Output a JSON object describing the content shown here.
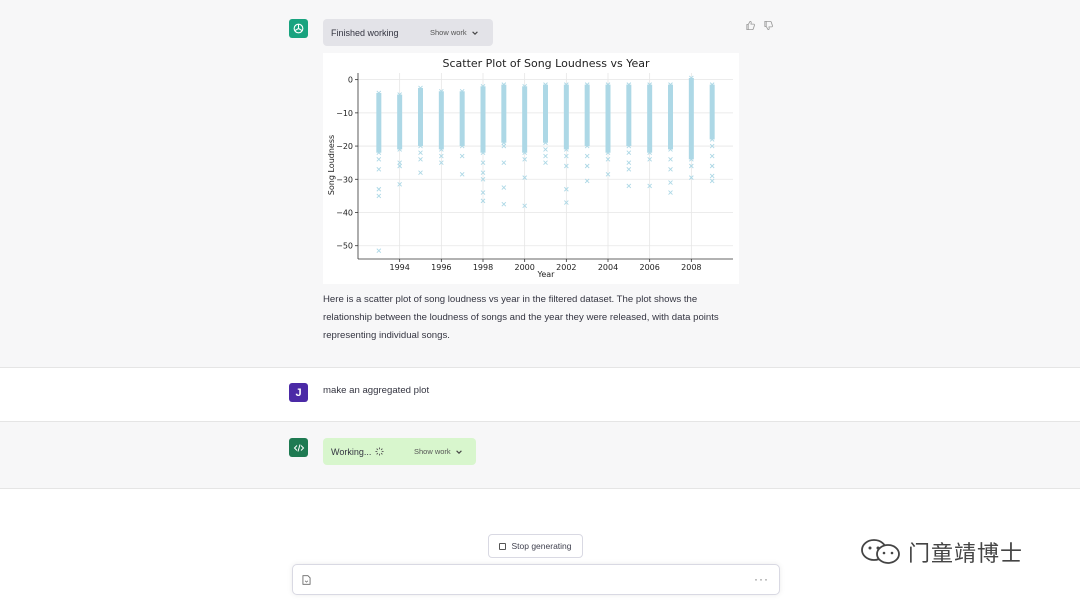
{
  "messages": {
    "assistant1": {
      "work_status": "Finished working",
      "show_work": "Show work",
      "paragraph": "Here is a scatter plot of song loudness vs year in the filtered dataset. The plot shows the relationship between the loudness of songs and the year they were released, with data points representing individual songs."
    },
    "user": {
      "avatar_letter": "J",
      "text": "make an aggregated plot"
    },
    "assistant2": {
      "work_status": "Working...",
      "show_work": "Show work"
    }
  },
  "controls": {
    "stop_label": "Stop generating",
    "more_label": "···"
  },
  "watermark": {
    "text": "门童靖博士"
  },
  "icons": {
    "gpt_avatar": "openai-logo-icon",
    "code_avatar": "code-icon",
    "thumbs_up": "thumbs-up-icon",
    "thumbs_down": "thumbs-down-icon",
    "spinner": "spinner-icon",
    "chevron": "chevron-down-icon",
    "stop": "stop-square-icon",
    "file": "file-icon"
  },
  "colors": {
    "gpt_green": "#19a37f",
    "user_purple": "#4b2aa6",
    "code_green": "#1e7a52",
    "working_bg": "#d8f6cd",
    "points": "#add8e6"
  },
  "chart_data": {
    "type": "scatter",
    "title": "Scatter Plot of Song Loudness vs Year",
    "xlabel": "Year",
    "ylabel": "Song Loudness",
    "xlim": [
      1992,
      2010
    ],
    "ylim": [
      -54,
      2
    ],
    "xticks": [
      1994,
      1996,
      1998,
      2000,
      2002,
      2004,
      2006,
      2008
    ],
    "yticks": [
      0,
      -10,
      -20,
      -30,
      -40,
      -50
    ],
    "grid": true,
    "marker": "x",
    "series": [
      {
        "points": [
          {
            "year": 1993,
            "band": [
              -4,
              -22
            ],
            "outliers": [
              -24,
              -27,
              -33,
              -35,
              -51.5
            ]
          },
          {
            "year": 1994,
            "band": [
              -4.5,
              -21
            ],
            "outliers": [
              -25,
              -26,
              -31.5
            ]
          },
          {
            "year": 1995,
            "band": [
              -2.5,
              -20
            ],
            "outliers": [
              -22,
              -24,
              -28
            ]
          },
          {
            "year": 1996,
            "band": [
              -3.5,
              -21
            ],
            "outliers": [
              -23,
              -25
            ]
          },
          {
            "year": 1997,
            "band": [
              -3.5,
              -20
            ],
            "outliers": [
              -23,
              -28.5
            ]
          },
          {
            "year": 1998,
            "band": [
              -2,
              -22
            ],
            "outliers": [
              -25,
              -28,
              -30,
              -34,
              -36.5
            ]
          },
          {
            "year": 1999,
            "band": [
              -1.5,
              -19
            ],
            "outliers": [
              -20,
              -25,
              -32.5,
              -37.5
            ]
          },
          {
            "year": 2000,
            "band": [
              -2,
              -22
            ],
            "outliers": [
              -24,
              -29.5,
              -38
            ]
          },
          {
            "year": 2001,
            "band": [
              -1.5,
              -19
            ],
            "outliers": [
              -21,
              -23,
              -25
            ]
          },
          {
            "year": 2002,
            "band": [
              -1.5,
              -21
            ],
            "outliers": [
              -23,
              -26,
              -33,
              -37
            ]
          },
          {
            "year": 2003,
            "band": [
              -1.5,
              -20
            ],
            "outliers": [
              -23,
              -26,
              -30.5
            ]
          },
          {
            "year": 2004,
            "band": [
              -1.5,
              -22
            ],
            "outliers": [
              -24,
              -28.5
            ]
          },
          {
            "year": 2005,
            "band": [
              -1.5,
              -20
            ],
            "outliers": [
              -22,
              -25,
              -27,
              -32
            ]
          },
          {
            "year": 2006,
            "band": [
              -1.5,
              -22
            ],
            "outliers": [
              -24,
              -32
            ]
          },
          {
            "year": 2007,
            "band": [
              -1.5,
              -21
            ],
            "outliers": [
              -24,
              -27,
              -31,
              -34
            ]
          },
          {
            "year": 2008,
            "band": [
              0.5,
              -24
            ],
            "outliers": [
              -26,
              -29.5
            ]
          },
          {
            "year": 2009,
            "band": [
              -1.5,
              -18
            ],
            "outliers": [
              -20,
              -23,
              -26,
              -29,
              -30.5
            ]
          }
        ]
      }
    ]
  }
}
